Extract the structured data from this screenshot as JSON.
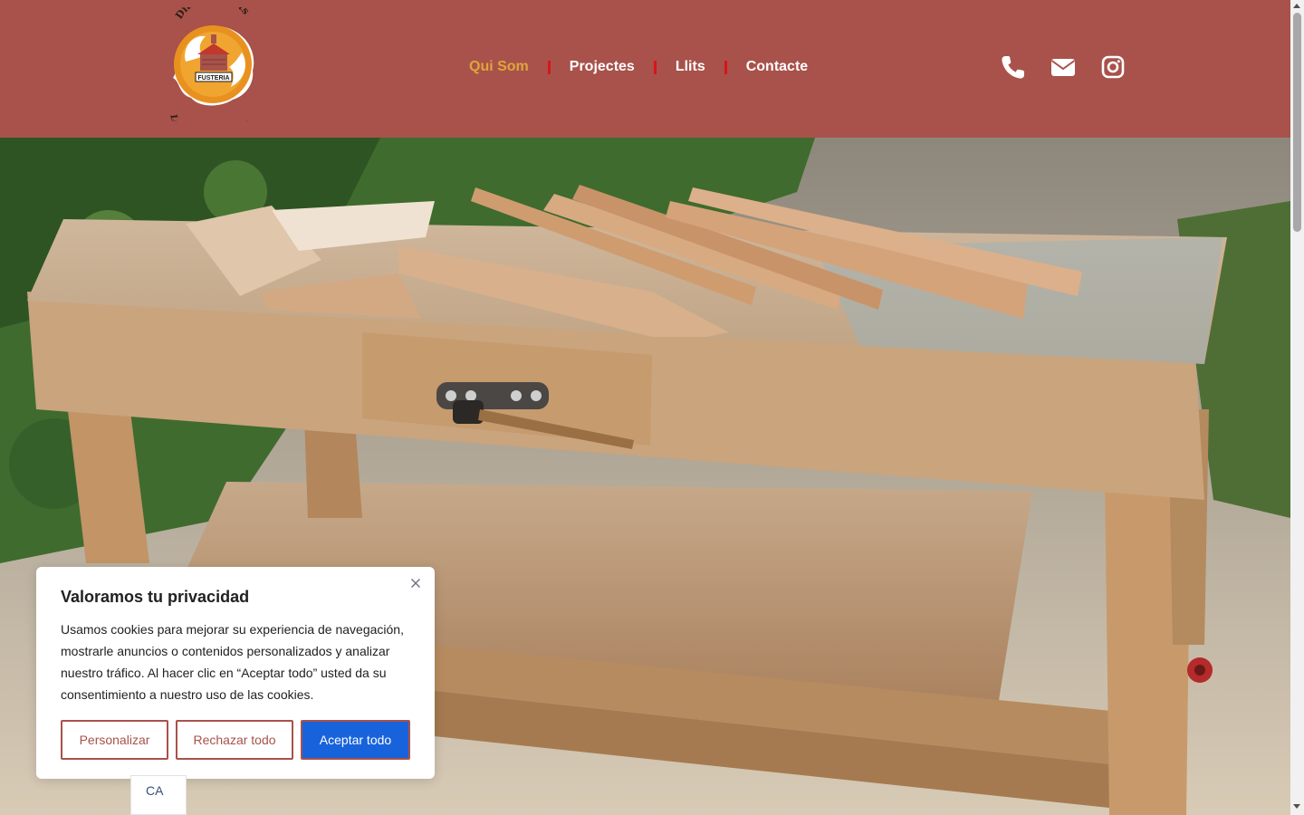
{
  "brand": {
    "logo_top_text": "Dia i Mil Llits",
    "logo_center_text": "FUSTERIA",
    "logo_bottom_text": "La Bisbal d'Empordà"
  },
  "nav": {
    "items": [
      {
        "label": "Qui Som",
        "active": true
      },
      {
        "label": "Projectes",
        "active": false
      },
      {
        "label": "Llits",
        "active": false
      },
      {
        "label": "Contacte",
        "active": false
      }
    ]
  },
  "header_icons": [
    "phone-icon",
    "envelope-icon",
    "instagram-icon"
  ],
  "colors": {
    "header_bg": "#a8524b",
    "nav_active": "#e0a53a",
    "nav_separator": "#d9141a",
    "accept_button": "#1863dc"
  },
  "cookie_banner": {
    "title": "Valoramos tu privacidad",
    "text": "Usamos cookies para mejorar su experiencia de navegación, mostrarle anuncios o contenidos personalizados y analizar nuestro tráfico. Al hacer clic en “Aceptar todo” usted da su consentimiento a nuestro uso de las cookies.",
    "customize_label": "Personalizar",
    "reject_label": "Rechazar todo",
    "accept_label": "Aceptar todo"
  },
  "language": {
    "current": "CA"
  }
}
